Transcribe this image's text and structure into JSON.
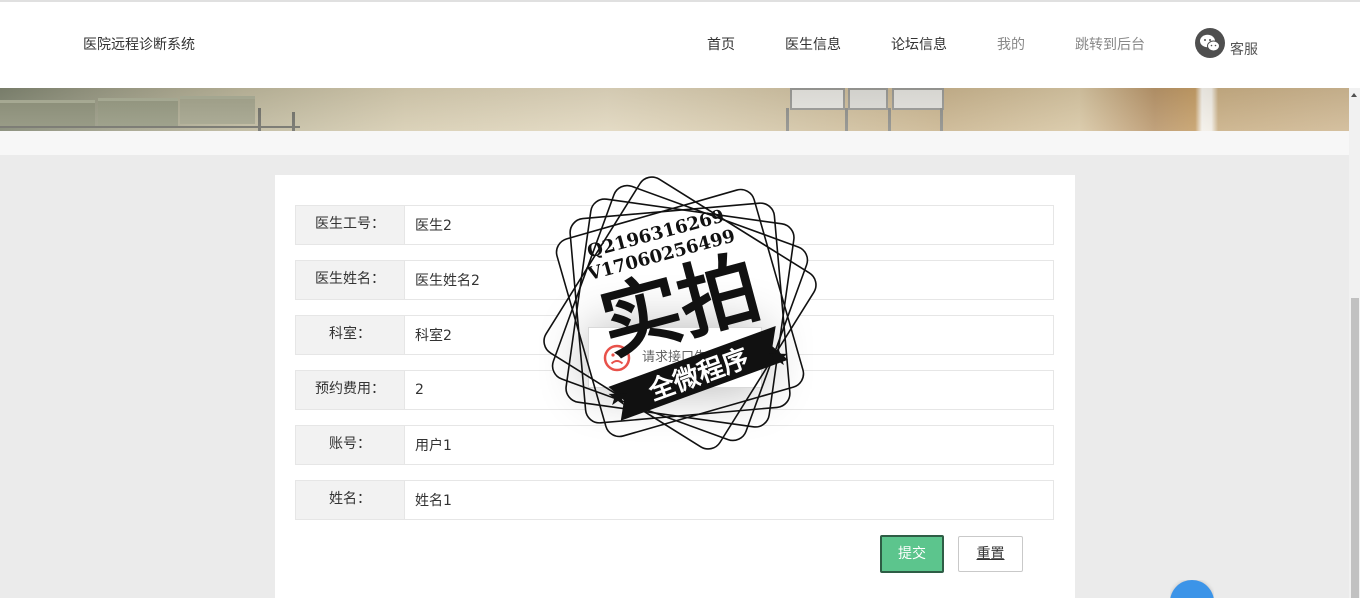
{
  "header": {
    "site_title": "医院远程诊断系统",
    "nav": [
      {
        "label": "首页"
      },
      {
        "label": "医生信息"
      },
      {
        "label": "论坛信息"
      },
      {
        "label": "我的"
      },
      {
        "label": "跳转到后台"
      }
    ],
    "service_icon": "wechat-icon",
    "service_label": "客服"
  },
  "form": {
    "fields": [
      {
        "label": "医生工号：",
        "value": "医生2"
      },
      {
        "label": "医生姓名：",
        "value": "医生姓名2"
      },
      {
        "label": "科室：",
        "value": "科室2"
      },
      {
        "label": "预约费用：",
        "value": "2"
      },
      {
        "label": "账号：",
        "value": "用户1"
      },
      {
        "label": "姓名：",
        "value": "姓名1"
      }
    ],
    "submit_label": "提交",
    "reset_label": "重置"
  },
  "toast": {
    "icon": "error-icon",
    "message": "请求接口失败"
  },
  "watermark": {
    "line1": "Q2196316269",
    "line2": "V17060256499",
    "main": "实拍",
    "ribbon": "全微程序"
  },
  "colors": {
    "submit_button": "#5cc58d",
    "float_button": "#3c94e8",
    "error": "#e8514a",
    "nav_active": "#333333",
    "nav_muted": "#888888"
  }
}
